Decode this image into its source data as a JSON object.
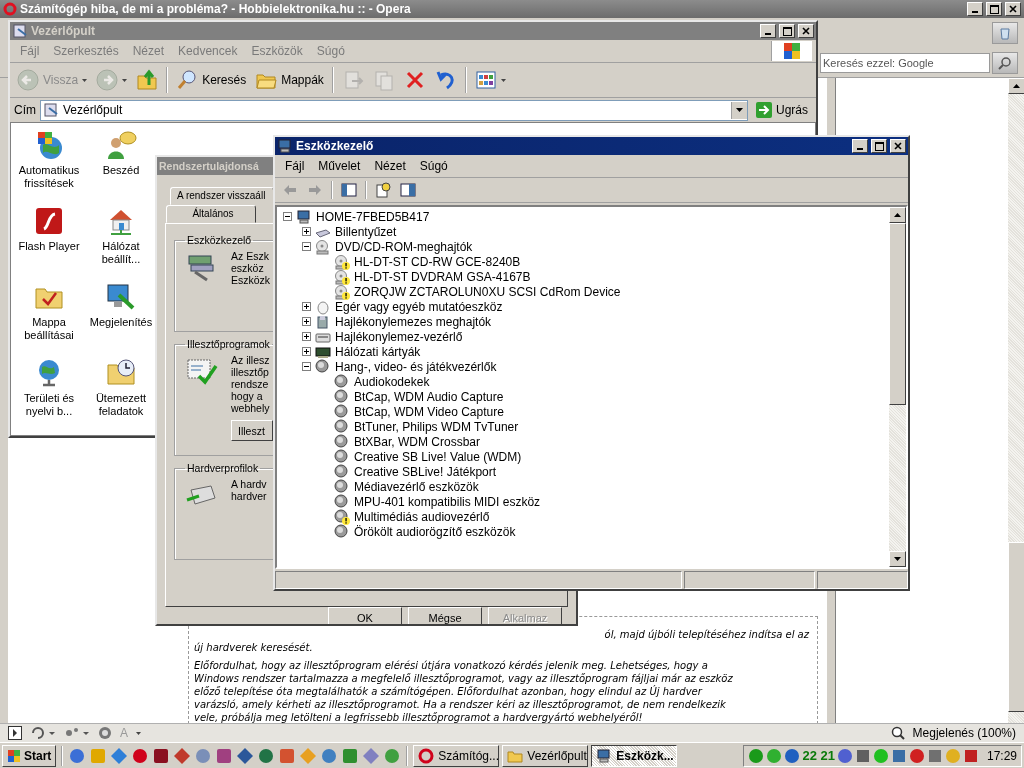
{
  "browser": {
    "title": "Számítógép hiba, de mi a probléma? - Hobbielektronika.hu :: - Opera",
    "search": {
      "placeholder": "Keresés ezzel: Google"
    },
    "paragraphs": [
      {
        "lines": [
          {
            "kind": "fragment",
            "text": "ól, majd újbóli telepítéséhez indítsa el az"
          },
          {
            "kind": "line",
            "text": "új hardverek keresését."
          }
        ]
      },
      {
        "lines": [
          {
            "kind": "line",
            "text": "Előfordulhat, hogy az illesztőprogram elérési útjára vonatkozó kérdés jelenik meg. Lehetséges, hogy a"
          },
          {
            "kind": "line",
            "text": "Windows rendszer tartalmazza a megfelelő illesztőprogramot, vagy az illesztőprogram fájljai már az eszköz"
          },
          {
            "kind": "line",
            "text": "előző telepítése óta megtalálhatók a számítógépen. Előfordulhat azonban, hogy elindul az Új hardver"
          },
          {
            "kind": "line",
            "text": "varázsló, amely kérheti az illesztőprogramot. Ha a rendszer kéri az illesztőprogramot, de nem rendelkezik"
          },
          {
            "kind": "line",
            "text": "vele, próbálja meg letölteni a legfrissebb illesztőprogramot a hardvergyártó webhelyéről!"
          }
        ]
      }
    ],
    "status_bar": {
      "text_icon": "A",
      "zoom": "Megjelenés (100%)"
    }
  },
  "control_panel": {
    "title": "Vezérlőpult",
    "menu": [
      "Fájl",
      "Szerkesztés",
      "Nézet",
      "Kedvencek",
      "Eszközök",
      "Súgó"
    ],
    "toolbar": [
      {
        "kind": "back",
        "label": "Vissza",
        "disabled": true
      },
      {
        "kind": "forward",
        "disabled": true
      },
      {
        "kind": "up",
        "disabled": false
      },
      {
        "kind": "search",
        "label": "Keresés",
        "disabled": false
      },
      {
        "kind": "folders",
        "label": "Mappák",
        "disabled": false
      },
      {
        "kind": "move",
        "disabled": true
      },
      {
        "kind": "copy",
        "disabled": true
      },
      {
        "kind": "delete",
        "disabled": false
      },
      {
        "kind": "undo",
        "disabled": false
      },
      {
        "kind": "views",
        "disabled": false
      }
    ],
    "address": {
      "label": "Cím",
      "value": "Vezérlőpult",
      "go": "Ugrás"
    },
    "items": [
      {
        "kind": "update",
        "label": "Automatikus frissítések"
      },
      {
        "kind": "speech",
        "label": "Beszéd"
      },
      {
        "kind": "flash",
        "label": "Flash Player"
      },
      {
        "kind": "network",
        "label": "Hálózat beállít..."
      },
      {
        "kind": "folder-options",
        "label": "Mappa beállításai"
      },
      {
        "kind": "display",
        "label": "Megjelenítés"
      },
      {
        "kind": "regional",
        "label": "Területi és nyelvi b..."
      },
      {
        "kind": "tasks",
        "label": "Ütemezett feladatok"
      }
    ]
  },
  "system_properties": {
    "title": "Rendszertulajdonsá",
    "tab_rows": [
      {
        "tabs": [
          {
            "label": "A rendszer visszaáll",
            "selected": false
          }
        ]
      },
      {
        "tabs": [
          {
            "label": "Általános",
            "selected": false
          }
        ]
      }
    ],
    "groups": [
      {
        "kind": "devices",
        "title": "Eszközkezelő",
        "lines": [
          "Az Eszk",
          "eszköz",
          "Eszközk"
        ]
      },
      {
        "kind": "drivers",
        "title": "Illesztőprogramok",
        "lines": [
          "Az illesz",
          "illesztőp",
          "rendsze",
          "hogy a",
          "webhely"
        ],
        "button": "Illeszt"
      },
      {
        "kind": "profiles",
        "title": "Hardverprofilok",
        "lines": [
          "A hardv",
          "hardver"
        ]
      }
    ],
    "buttons": [
      {
        "label": "OK",
        "disabled": false
      },
      {
        "label": "Mégse",
        "disabled": false
      },
      {
        "label": "Alkalmaz",
        "disabled": true
      }
    ]
  },
  "device_manager": {
    "title": "Eszközkezelő",
    "menu": [
      "Fájl",
      "Művelet",
      "Nézet",
      "Súgó"
    ],
    "tree": {
      "label": "HOME-7FBED5B417",
      "kind": "computer",
      "expanded": true,
      "children": [
        {
          "label": "Billentyűzet",
          "kind": "keyboard",
          "expanded": false
        },
        {
          "label": "DVD/CD-ROM-meghajtók",
          "kind": "disc",
          "expanded": true,
          "children": [
            {
              "label": "HL-DT-ST CD-RW GCE-8240B",
              "kind": "disc",
              "warning": true
            },
            {
              "label": "HL-DT-ST DVDRAM GSA-4167B",
              "kind": "disc",
              "warning": true
            },
            {
              "label": "ZORQJW ZCTAROLUN0XU SCSI CdRom Device",
              "kind": "disc",
              "warning": true
            }
          ]
        },
        {
          "label": "Egér vagy egyéb mutatóeszköz",
          "kind": "mouse",
          "expanded": false
        },
        {
          "label": "Hajlékonylemezes meghajtók",
          "kind": "floppy",
          "expanded": false
        },
        {
          "label": "Hajlékonylemez-vezérlő",
          "kind": "controller",
          "expanded": false
        },
        {
          "label": "Hálózati kártyák",
          "kind": "network",
          "expanded": false
        },
        {
          "label": "Hang-, video- és játékvezérlők",
          "kind": "sound",
          "expanded": true,
          "children": [
            {
              "label": "Audiokodekek",
              "kind": "sound",
              "warning": false
            },
            {
              "label": "BtCap, WDM Audio Capture",
              "kind": "sound",
              "warning": false
            },
            {
              "label": "BtCap, WDM Video Capture",
              "kind": "sound",
              "warning": false
            },
            {
              "label": "BtTuner, Philips WDM TvTuner",
              "kind": "sound",
              "warning": false
            },
            {
              "label": "BtXBar, WDM Crossbar",
              "kind": "sound",
              "warning": false
            },
            {
              "label": "Creative SB Live! Value (WDM)",
              "kind": "sound",
              "warning": false
            },
            {
              "label": "Creative SBLive! Játékport",
              "kind": "sound",
              "warning": false
            },
            {
              "label": "Médiavezérlő eszközök",
              "kind": "sound",
              "warning": false
            },
            {
              "label": "MPU-401 kompatibilis MIDI eszköz",
              "kind": "sound",
              "warning": false
            },
            {
              "label": "Multimédiás audiovezérlő",
              "kind": "sound",
              "warning": true
            },
            {
              "label": "Örökölt audiorögzítő eszközök",
              "kind": "sound",
              "warning": false
            }
          ]
        }
      ]
    }
  },
  "taskbar": {
    "start": "Start",
    "tasks": [
      {
        "kind": "browser",
        "label": "Számítóg...",
        "selected": false
      },
      {
        "kind": "folder",
        "label": "Vezérlőpult",
        "selected": false
      },
      {
        "kind": "computer",
        "label": "Eszközk...",
        "selected": true
      }
    ],
    "tray_text": "22 21",
    "clock": "17:29"
  }
}
